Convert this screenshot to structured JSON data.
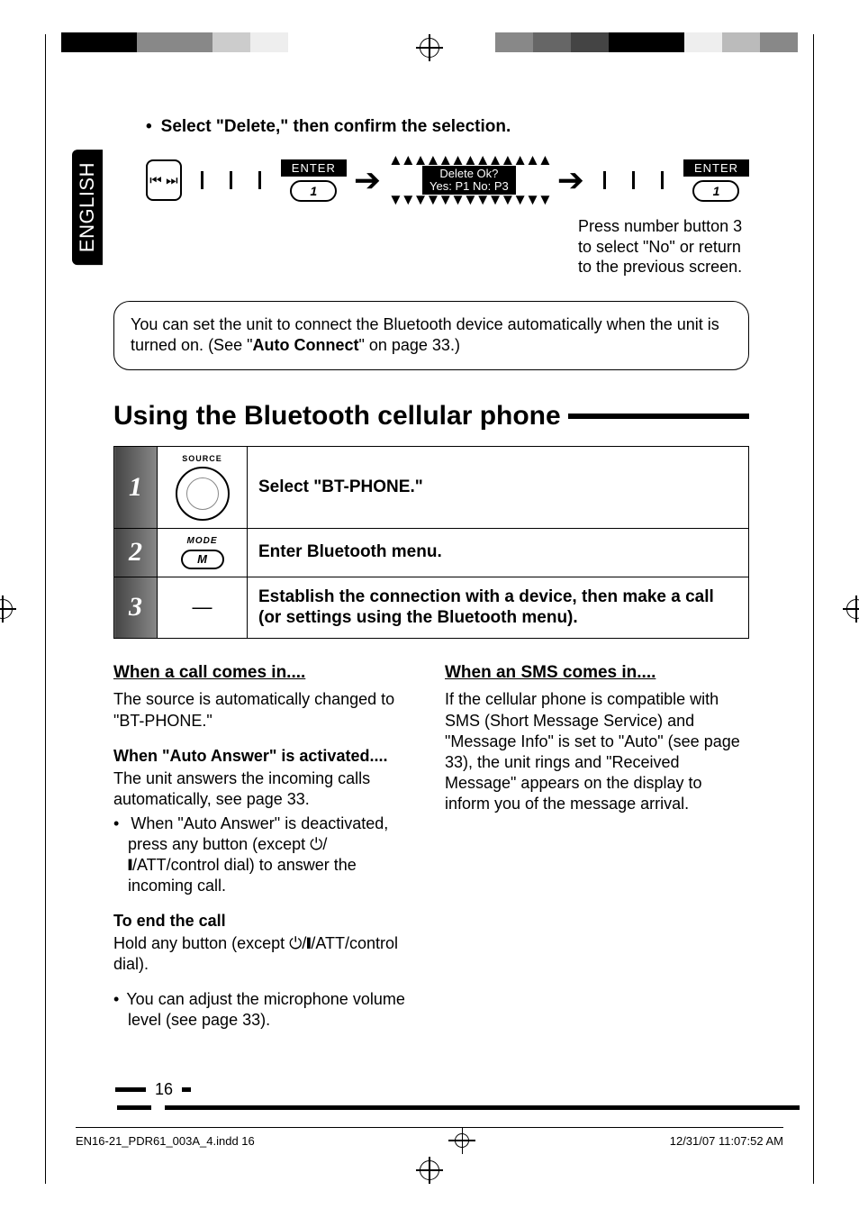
{
  "side_tab": "ENGLISH",
  "top_instruction": "Select \"Delete,\" then confirm the selection.",
  "enter_label": "ENTER",
  "num_button_label": "1",
  "lcd_line1": "Delete Ok?",
  "lcd_line2": "Yes: P1   No: P3",
  "side_note": "Press number button 3 to select \"No\" or return to the previous screen.",
  "info_box_pre": "You can set the unit to connect the Bluetooth device automatically when the unit is turned on. (See \"",
  "info_box_bold": "Auto Connect",
  "info_box_post": "\" on page 33.)",
  "section_title": "Using the Bluetooth cellular phone",
  "steps": [
    {
      "num": "1",
      "icon_top": "SOURCE",
      "icon_sub": "",
      "text": "Select \"BT-PHONE.\""
    },
    {
      "num": "2",
      "icon_top": "MODE",
      "icon_sub": "M",
      "text": "Enter Bluetooth menu."
    },
    {
      "num": "3",
      "icon_top": "",
      "icon_sub": "—",
      "text": "Establish the connection with a device, then make a call (or settings using the Bluetooth menu)."
    }
  ],
  "left_col": {
    "subhead": "When a call comes in....",
    "p1": "The source is automatically changed to \"BT-PHONE.\"",
    "sub2": "When \"Auto Answer\" is activated....",
    "p2": "The unit answers the incoming calls automatically, see page 33.",
    "li1_pre": "When \"Auto Answer\" is deactivated, press any button (except ",
    "li1_icon": "⏻/❙/ATT",
    "li1_post": "/control dial) to answer the incoming call.",
    "sub3": "To end the call",
    "p3_pre": "Hold any button (except ",
    "p3_icon": "⏻/❙/ATT",
    "p3_post": "/control dial).",
    "li2": "You can adjust the microphone volume level (see page 33)."
  },
  "right_col": {
    "subhead": "When an SMS comes in....",
    "p1": "If the cellular phone is compatible with SMS (Short Message Service) and \"Message Info\" is set to \"Auto\" (see page 33), the unit rings and \"Received Message\" appears on the display to inform you of the message arrival."
  },
  "page_number": "16",
  "footer_file": "EN16-21_PDR61_003A_4.indd   16",
  "footer_date": "12/31/07   11:07:52 AM",
  "color_bars_left": [
    "#000",
    "#000",
    "#888",
    "#888",
    "#ccc",
    "#eee"
  ],
  "color_bars_right": [
    "#888",
    "#666",
    "#444",
    "#000",
    "#000",
    "#eee",
    "#bbb",
    "#888"
  ]
}
